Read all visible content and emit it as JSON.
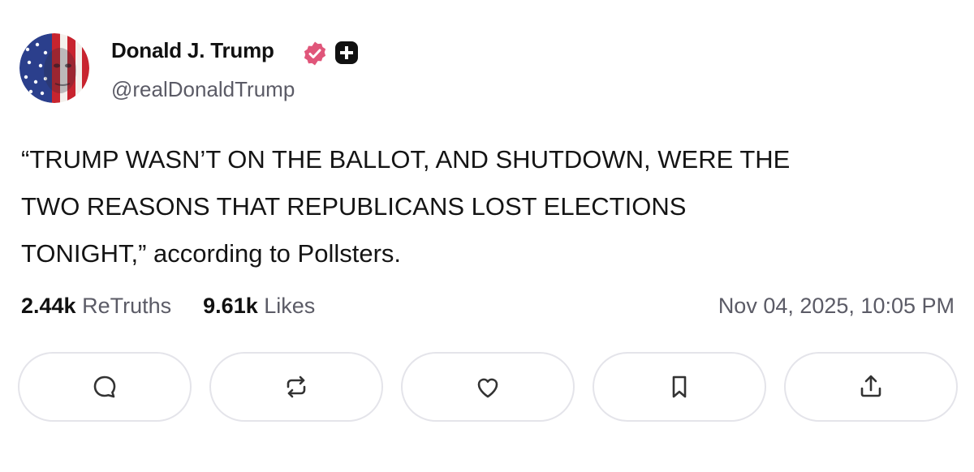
{
  "author": {
    "name": "Donald J. Trump",
    "handle": "@realDonaldTrump",
    "verified_icon": "verified-badge-icon",
    "plus_icon": "plus-badge-icon",
    "colors": {
      "verified": "#e0567a",
      "plus_badge": "#111111"
    }
  },
  "post": {
    "text_lines": [
      "“TRUMP WASN’T ON THE BALLOT, AND SHUTDOWN, WERE THE",
      "TWO REASONS THAT REPUBLICANS LOST ELECTIONS",
      "TONIGHT,” according to Pollsters."
    ]
  },
  "stats": {
    "retruths_count": "2.44k",
    "retruths_label": "ReTruths",
    "likes_count": "9.61k",
    "likes_label": "Likes",
    "timestamp": "Nov 04, 2025, 10:05 PM"
  },
  "actions": [
    {
      "name": "reply",
      "icon": "comment-icon"
    },
    {
      "name": "retruth",
      "icon": "repost-icon"
    },
    {
      "name": "like",
      "icon": "heart-icon"
    },
    {
      "name": "bookmark",
      "icon": "bookmark-icon"
    },
    {
      "name": "share",
      "icon": "share-icon"
    }
  ]
}
